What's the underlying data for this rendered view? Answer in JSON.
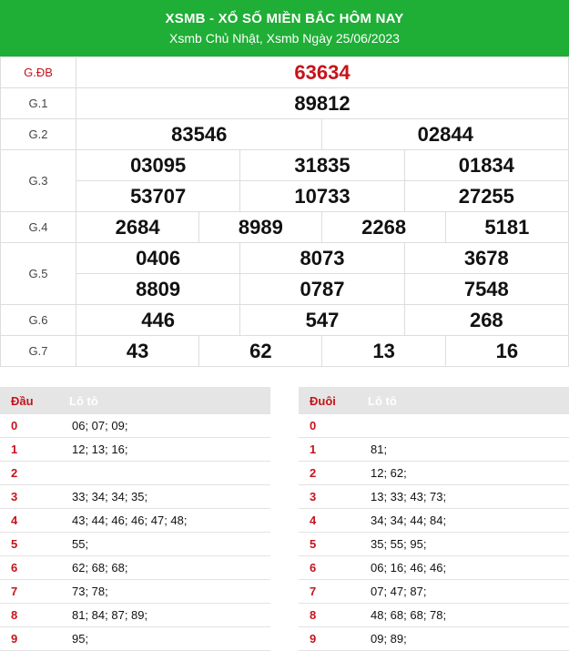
{
  "header": {
    "title": "XSMB - XỔ SỐ MIỀN BẮC HÔM NAY",
    "subtitle": "Xsmb Chủ Nhật, Xsmb Ngày 25/06/2023"
  },
  "results": {
    "g_db": {
      "label": "G.ĐB",
      "values": [
        "63634"
      ]
    },
    "g1": {
      "label": "G.1",
      "values": [
        "89812"
      ]
    },
    "g2": {
      "label": "G.2",
      "values": [
        "83546",
        "02844"
      ]
    },
    "g3": {
      "label": "G.3",
      "values": [
        "03095",
        "31835",
        "01834",
        "53707",
        "10733",
        "27255"
      ]
    },
    "g4": {
      "label": "G.4",
      "values": [
        "2684",
        "8989",
        "2268",
        "5181"
      ]
    },
    "g5": {
      "label": "G.5",
      "values": [
        "0406",
        "8073",
        "3678",
        "8809",
        "0787",
        "7548"
      ]
    },
    "g6": {
      "label": "G.6",
      "values": [
        "446",
        "547",
        "268"
      ]
    },
    "g7": {
      "label": "G.7",
      "values": [
        "43",
        "62",
        "13",
        "16"
      ]
    }
  },
  "loto_dau": {
    "head_key": "Đầu",
    "head_val": "Lô tô",
    "rows": [
      {
        "key": "0",
        "val": "06; 07; 09;"
      },
      {
        "key": "1",
        "val": "12; 13; 16;"
      },
      {
        "key": "2",
        "val": ""
      },
      {
        "key": "3",
        "val": "33; 34; 34; 35;"
      },
      {
        "key": "4",
        "val": "43; 44; 46; 46; 47; 48;"
      },
      {
        "key": "5",
        "val": "55;"
      },
      {
        "key": "6",
        "val": "62; 68; 68;"
      },
      {
        "key": "7",
        "val": "73; 78;"
      },
      {
        "key": "8",
        "val": "81; 84; 87; 89;"
      },
      {
        "key": "9",
        "val": "95;"
      }
    ]
  },
  "loto_duoi": {
    "head_key": "Đuôi",
    "head_val": "Lô tô",
    "rows": [
      {
        "key": "0",
        "val": ""
      },
      {
        "key": "1",
        "val": "81;"
      },
      {
        "key": "2",
        "val": "12; 62;"
      },
      {
        "key": "3",
        "val": "13; 33; 43; 73;"
      },
      {
        "key": "4",
        "val": "34; 34; 44; 84;"
      },
      {
        "key": "5",
        "val": "35; 55; 95;"
      },
      {
        "key": "6",
        "val": "06; 16; 46; 46;"
      },
      {
        "key": "7",
        "val": "07; 47; 87;"
      },
      {
        "key": "8",
        "val": "48; 68; 68; 78;"
      },
      {
        "key": "9",
        "val": "09; 89;"
      }
    ]
  },
  "colors": {
    "header_bg": "#1fae36",
    "special_red": "#c6131b",
    "table_head_bg": "#e5e5e5"
  }
}
